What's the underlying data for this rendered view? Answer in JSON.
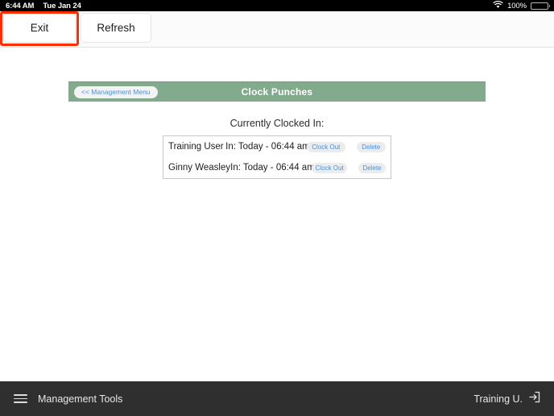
{
  "status_bar": {
    "time": "6:44 AM",
    "date": "Tue Jan 24",
    "battery_percent": "100%",
    "wifi_icon": "wifi-icon",
    "battery_icon": "battery-icon"
  },
  "toolbar": {
    "exit_label": "Exit",
    "refresh_label": "Refresh",
    "focused_button": "Exit",
    "focus_color": "#ff2d00"
  },
  "header": {
    "back_label": "<< Management Menu",
    "title": "Clock Punches",
    "background_color": "#81ab8c"
  },
  "main": {
    "section_label": "Currently Clocked In:",
    "rows": [
      {
        "name": "Training User",
        "time": "In: Today - 06:44 am",
        "clock_out_label": "Clock Out",
        "delete_label": "Delete"
      },
      {
        "name": "Ginny Weasley",
        "time": "In: Today - 06:44 am",
        "clock_out_label": "Clock Out",
        "delete_label": "Delete"
      }
    ]
  },
  "bottom_bar": {
    "menu_icon": "hamburger-icon",
    "menu_label": "Management Tools",
    "user_label": "Training U.",
    "logout_icon": "sign-out-icon",
    "background_color": "#2f2f2f"
  }
}
